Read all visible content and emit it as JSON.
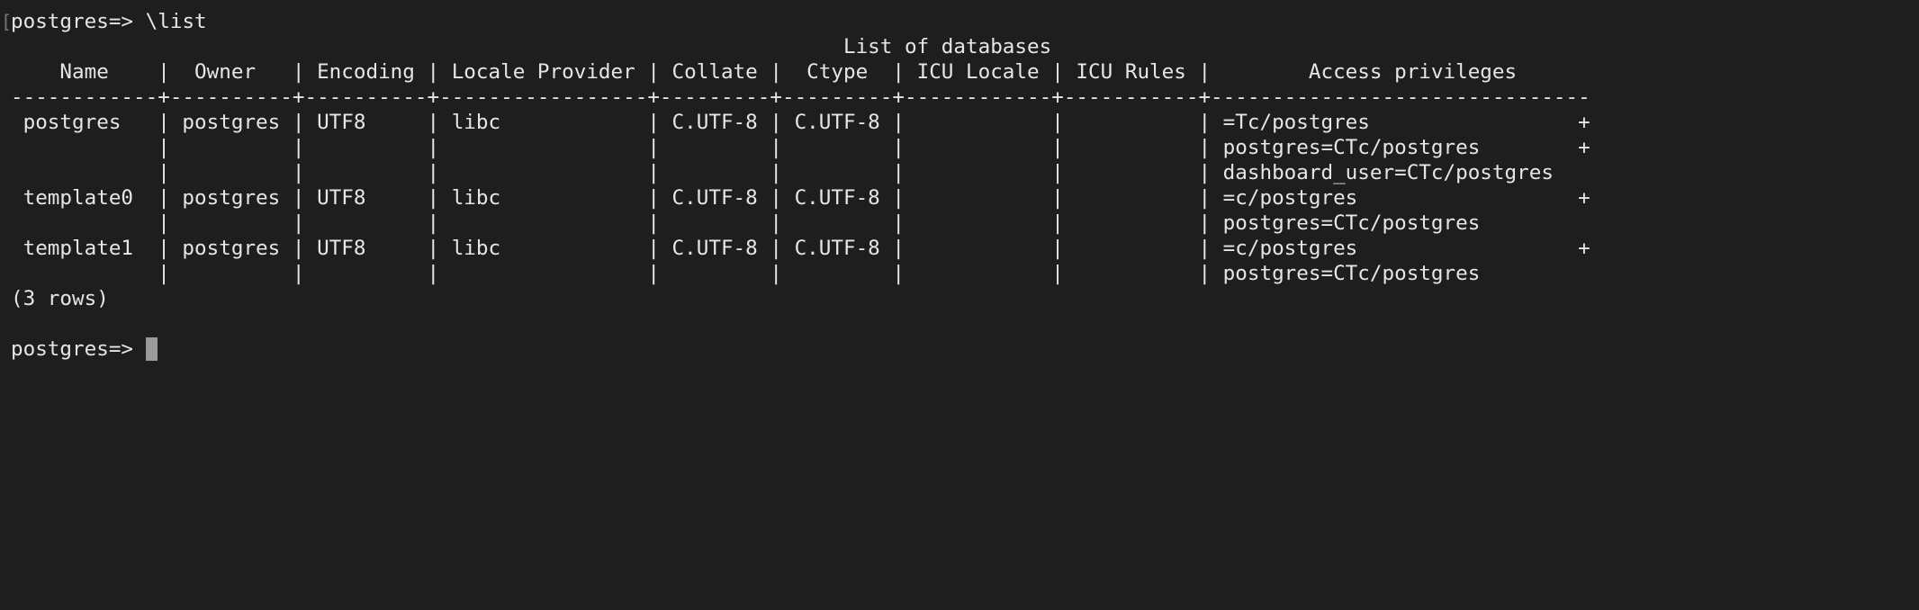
{
  "terminal": {
    "first_prompt": "postgres=> ",
    "first_command": "\\list",
    "output_lines": [
      "                                                                    List of databases",
      "    Name    |  Owner   | Encoding | Locale Provider | Collate |  Ctype  | ICU Locale | ICU Rules |        Access privileges",
      "------------+----------+----------+-----------------+---------+---------+------------+-----------+-------------------------------",
      " postgres   | postgres | UTF8     | libc            | C.UTF-8 | C.UTF-8 |            |           | =Tc/postgres                 +",
      "            |          |          |                 |         |         |            |           | postgres=CTc/postgres        +",
      "            |          |          |                 |         |         |            |           | dashboard_user=CTc/postgres",
      " template0  | postgres | UTF8     | libc            | C.UTF-8 | C.UTF-8 |            |           | =c/postgres                  +",
      "            |          |          |                 |         |         |            |           | postgres=CTc/postgres",
      " template1  | postgres | UTF8     | libc            | C.UTF-8 | C.UTF-8 |            |           | =c/postgres                  +",
      "            |          |          |                 |         |         |            |           | postgres=CTc/postgres",
      "(3 rows)",
      ""
    ],
    "second_prompt": "postgres=> "
  },
  "colors": {
    "background": "#1e1e1e",
    "foreground": "#e6e6e6",
    "cursor": "#9a9a9a"
  }
}
